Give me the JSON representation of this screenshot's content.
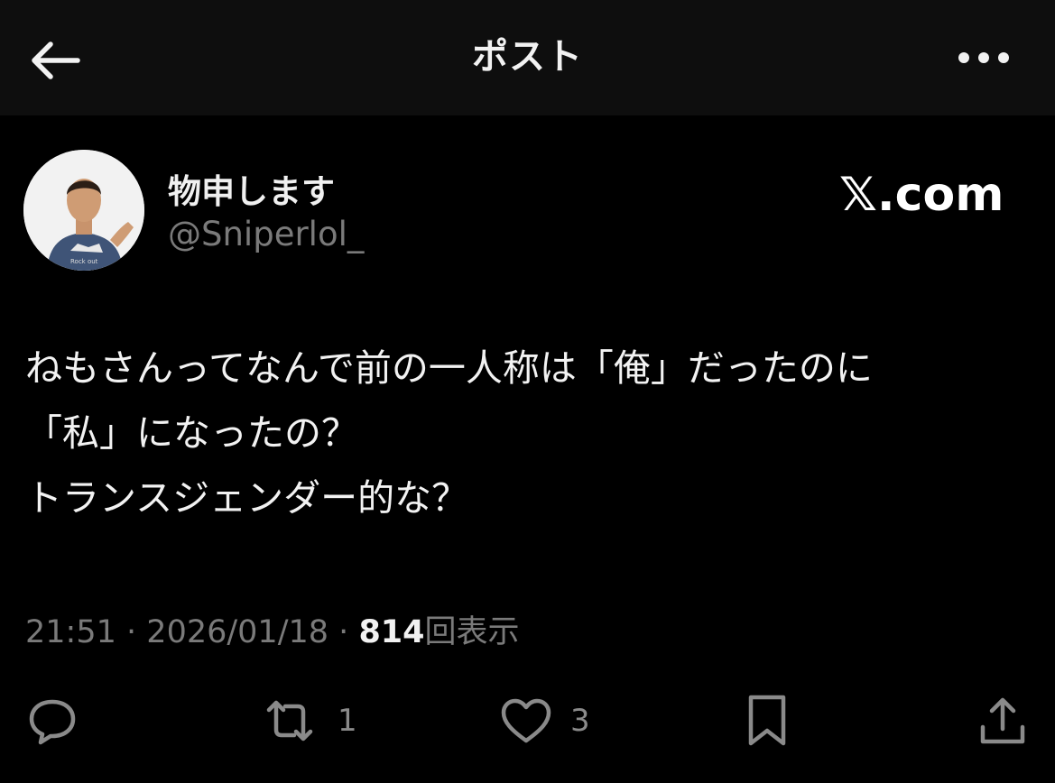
{
  "header": {
    "title": "ポスト",
    "back_icon": "arrow-left-icon",
    "more_icon": "more-horizontal-icon"
  },
  "author": {
    "display_name": "物申します",
    "handle": "@Sniperlol_",
    "avatar_shirt_text": "Rock out"
  },
  "site_logo": "𝕏.com",
  "post": {
    "lines": [
      "ねもさんってなんで前の一人称は「俺」だったのに",
      "「私」になったの？",
      "トランスジェンダー的な？"
    ]
  },
  "meta": {
    "time": "21:51",
    "separator": "·",
    "date": "2026/01/18",
    "views_count": "814",
    "views_label": "回表示"
  },
  "actions": {
    "reply": {
      "icon": "reply-bubble-icon",
      "count": ""
    },
    "repost": {
      "icon": "repost-icon",
      "count": "1"
    },
    "like": {
      "icon": "heart-icon",
      "count": "3"
    },
    "bookmark": {
      "icon": "bookmark-icon",
      "count": ""
    },
    "share": {
      "icon": "share-upload-icon",
      "count": ""
    }
  },
  "colors": {
    "background": "#000000",
    "topbar": "#0e0e0e",
    "text_primary": "#f2f2f2",
    "text_secondary": "#7a7a7a",
    "icon_gray": "#8a8a8a"
  }
}
